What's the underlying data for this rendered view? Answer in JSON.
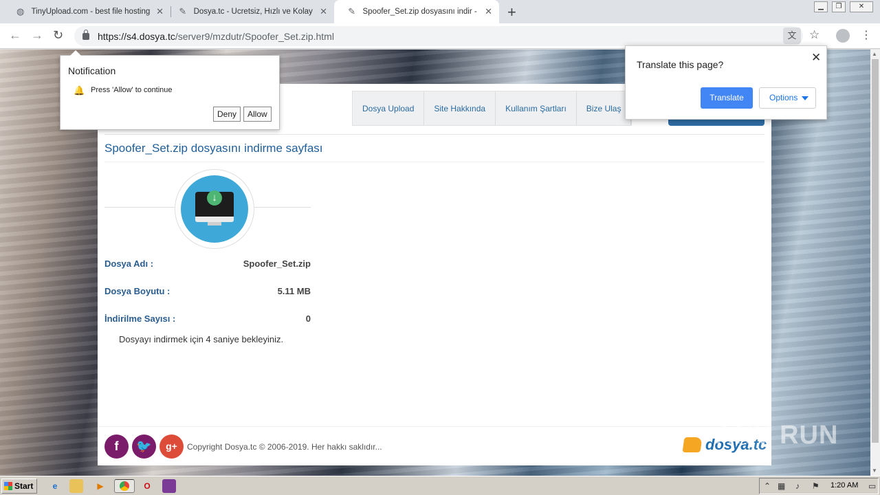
{
  "browser": {
    "tabs": [
      {
        "title": "TinyUpload.com - best file hosting so",
        "favicon": "globe-icon",
        "active": false
      },
      {
        "title": "Dosya.tc - Ücretsiz, Hızlı ve Kolay Do",
        "favicon": "dosya-favicon",
        "active": false
      },
      {
        "title": "Spoofer_Set.zip dosyasını indir - dov",
        "favicon": "dosya-favicon",
        "active": true
      }
    ],
    "url_host": "https://s4.dosya.tc",
    "url_path": "/server9/mzdutr/Spoofer_Set.zip.html"
  },
  "notification": {
    "title": "Notification",
    "message": "Press 'Allow' to continue",
    "deny_label": "Deny",
    "allow_label": "Allow"
  },
  "translate_popup": {
    "title": "Translate this page?",
    "translate_label": "Translate",
    "options_label": "Options"
  },
  "site": {
    "logo_text": "dosya",
    "logo_tld": ".tc",
    "nav": [
      "Dosya Upload",
      "Site Hakkında",
      "Kullanım Şartları",
      "Bize Ulaş"
    ],
    "page_title": "Spoofer_Set.zip dosyasını indirme sayfası",
    "info": [
      {
        "label": "Dosya Adı :",
        "value": "Spoofer_Set.zip"
      },
      {
        "label": "Dosya Boyutu :",
        "value": "5.11 MB"
      },
      {
        "label": "İndirilme Sayısı :",
        "value": "0"
      }
    ],
    "wait_message": "Dosyayı indirmek için 4 saniye bekleyiniz.",
    "copyright": "Copyright Dosya.tc © 2006-2019. Her hakkı saklıdır..."
  },
  "watermark": "ANY RUN",
  "taskbar": {
    "start_label": "Start",
    "clock": "1:20 AM"
  },
  "colors": {
    "accent": "#1f5e9a",
    "translate_button": "#4285f4",
    "social": "#7b1c6b",
    "google_plus": "#dd4b39"
  }
}
